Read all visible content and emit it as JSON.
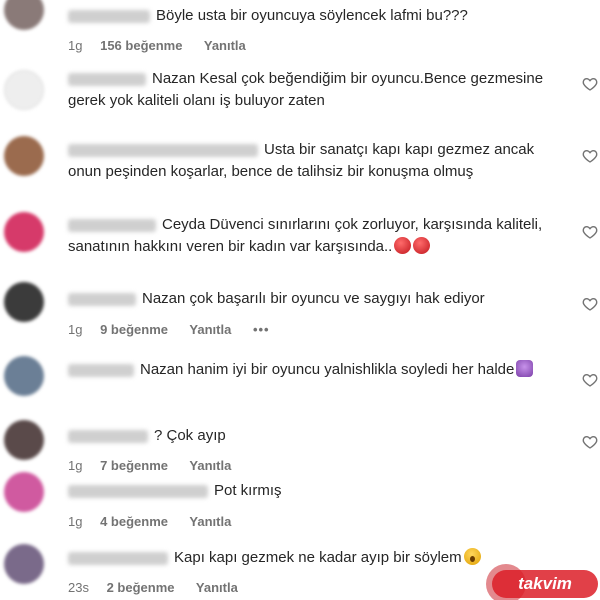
{
  "comments": [
    {
      "text": "Böyle usta bir oyuncuya söylencek lafmi bu???",
      "time": "1g",
      "likes": "156 beğenme",
      "reply": "Yanıtla",
      "avatar_color": "#8a7a78"
    },
    {
      "text": "Nazan Kesal çok beğendiğim bir oyuncu.Bence gezmesine gerek yok kaliteli olanı iş buluyor zaten",
      "avatar_color": "#ffffff"
    },
    {
      "text": "Usta bir sanatçı kapı kapı gezmez ancak onun peşinden koşarlar, bence de talihsiz bir konuşma olmuş",
      "avatar_color": "#9b6b4e"
    },
    {
      "text": "Ceyda Düvenci sınırlarını çok zorluyor, karşısında kaliteli, sanatının hakkını veren bir kadın var karşısında..",
      "avatar_color": "#d63a6a"
    },
    {
      "text": "Nazan çok başarılı bir oyuncu ve saygıyı hak ediyor",
      "time": "1g",
      "likes": "9 beğenme",
      "reply": "Yanıtla",
      "more": "•••",
      "avatar_color": "#3b3b3b"
    },
    {
      "text": "Nazan hanim iyi bir oyuncu yalnishlikla soyledi her halde",
      "avatar_color": "#6b7f96"
    },
    {
      "text": "? Çok ayıp",
      "time": "1g",
      "likes": "7 beğenme",
      "reply": "Yanıtla",
      "avatar_color": "#5a4a4a"
    },
    {
      "text": "Pot kırmış",
      "time": "1g",
      "likes": "4 beğenme",
      "reply": "Yanıtla",
      "avatar_color": "#d05aa0"
    },
    {
      "text": "Kapı kapı gezmek ne kadar ayıp bir söylem",
      "time": "23s",
      "likes": "2 beğenme",
      "reply": "Yanıtla",
      "avatar_color": "#7a6a8a"
    }
  ],
  "watermark": "takvim",
  "icons": {
    "like": "heart-outline-icon",
    "more": "more-horizontal-icon"
  }
}
